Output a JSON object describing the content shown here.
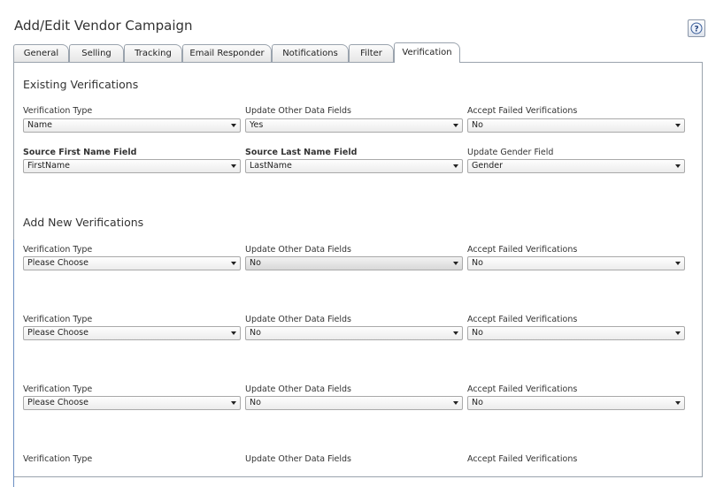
{
  "page": {
    "title": "Add/Edit Vendor Campaign"
  },
  "tabs": [
    {
      "label": "General"
    },
    {
      "label": "Selling"
    },
    {
      "label": "Tracking"
    },
    {
      "label": "Email Responder"
    },
    {
      "label": "Notifications"
    },
    {
      "label": "Filter"
    },
    {
      "label": "Verification",
      "active": true
    }
  ],
  "existing": {
    "title": "Existing Verifications",
    "row1": {
      "verification_type": {
        "label": "Verification Type",
        "value": "Name"
      },
      "update_other": {
        "label": "Update Other Data Fields",
        "value": "Yes"
      },
      "accept_failed": {
        "label": "Accept Failed Verifications",
        "value": "No"
      }
    },
    "row2": {
      "source_first": {
        "label": "Source First Name Field",
        "value": "FirstName"
      },
      "source_last": {
        "label": "Source Last Name Field",
        "value": "LastName"
      },
      "update_gender": {
        "label": "Update Gender Field",
        "value": "Gender"
      }
    }
  },
  "add_new": {
    "title": "Add New Verifications",
    "rows": [
      {
        "type_label": "Verification Type",
        "type_value": "Please Choose",
        "update_label": "Update Other Data Fields",
        "update_value": "No",
        "accept_label": "Accept Failed Verifications",
        "accept_value": "No"
      },
      {
        "type_label": "Verification Type",
        "type_value": "Please Choose",
        "update_label": "Update Other Data Fields",
        "update_value": "No",
        "accept_label": "Accept Failed Verifications",
        "accept_value": "No"
      },
      {
        "type_label": "Verification Type",
        "type_value": "Please Choose",
        "update_label": "Update Other Data Fields",
        "update_value": "No",
        "accept_label": "Accept Failed Verifications",
        "accept_value": "No"
      },
      {
        "type_label": "Verification Type",
        "update_label": "Update Other Data Fields",
        "accept_label": "Accept Failed Verifications"
      }
    ]
  }
}
